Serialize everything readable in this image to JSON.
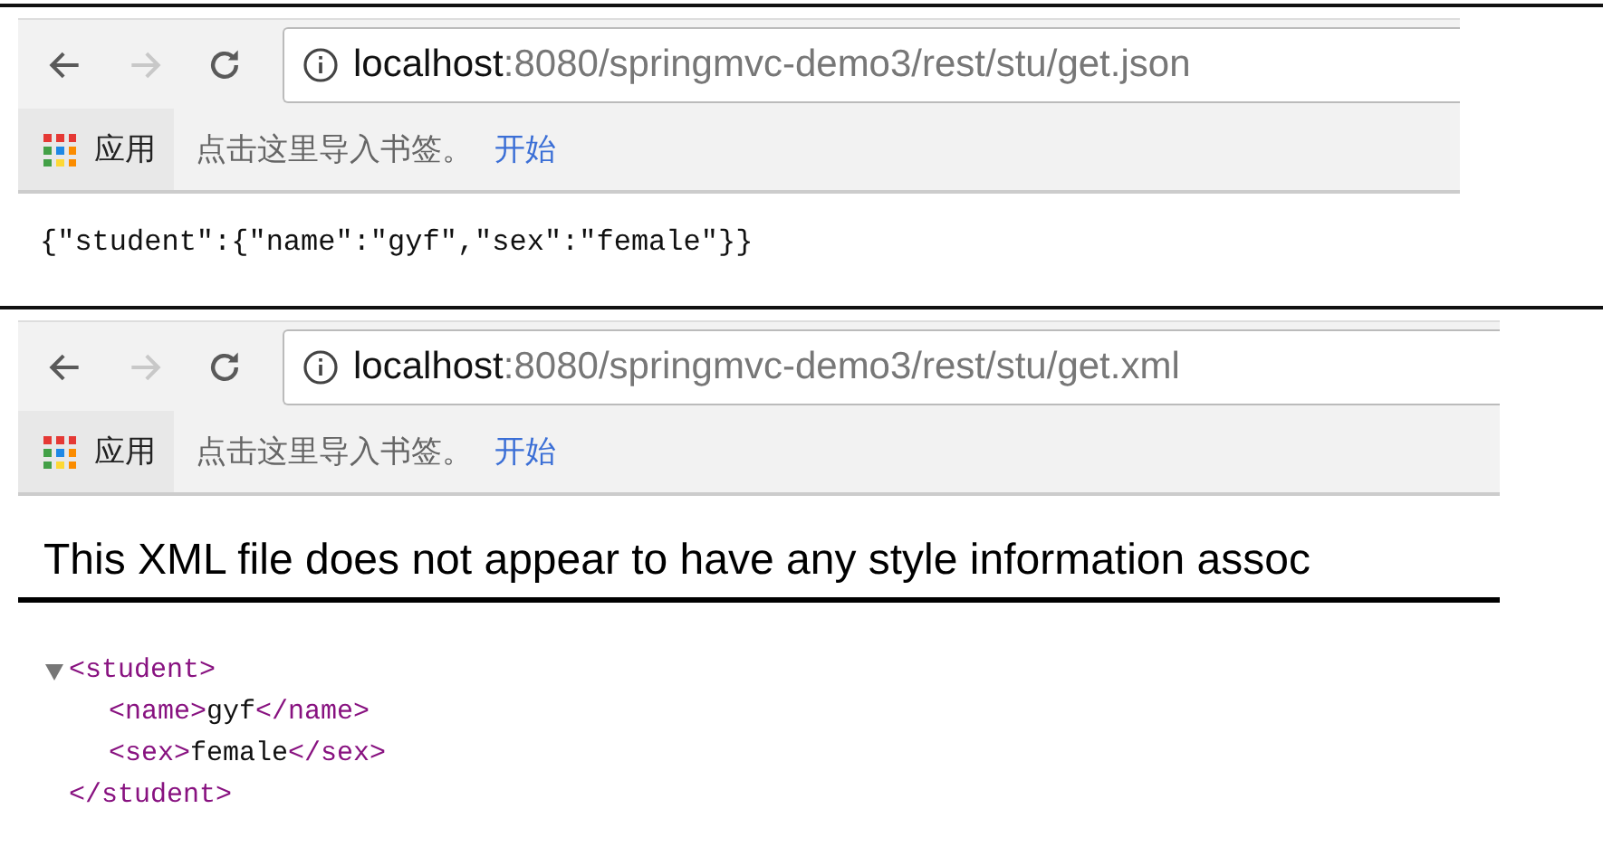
{
  "windows": [
    {
      "nav": {
        "back_disabled": false,
        "forward_disabled": true
      },
      "address": {
        "host": "localhost",
        "path": ":8080/springmvc-demo3/rest/stu/get.json"
      },
      "bookmarks": {
        "apps": "应用",
        "hint": "点击这里导入书签。",
        "link": "开始"
      },
      "content": {
        "kind": "json",
        "text": "{\"student\":{\"name\":\"gyf\",\"sex\":\"female\"}}"
      }
    },
    {
      "nav": {
        "back_disabled": false,
        "forward_disabled": true
      },
      "address": {
        "host": "localhost",
        "path": ":8080/springmvc-demo3/rest/stu/get.xml"
      },
      "bookmarks": {
        "apps": "应用",
        "hint": "点击这里导入书签。",
        "link": "开始"
      },
      "content": {
        "kind": "xml",
        "notice": "This XML file does not appear to have any style information assoc",
        "tree": {
          "open": "<student>",
          "close": "</student>",
          "expanded": true,
          "children": [
            {
              "open": "<name>",
              "text": "gyf",
              "close": "</name>"
            },
            {
              "open": "<sex>",
              "text": "female",
              "close": "</sex>"
            }
          ]
        }
      }
    }
  ]
}
